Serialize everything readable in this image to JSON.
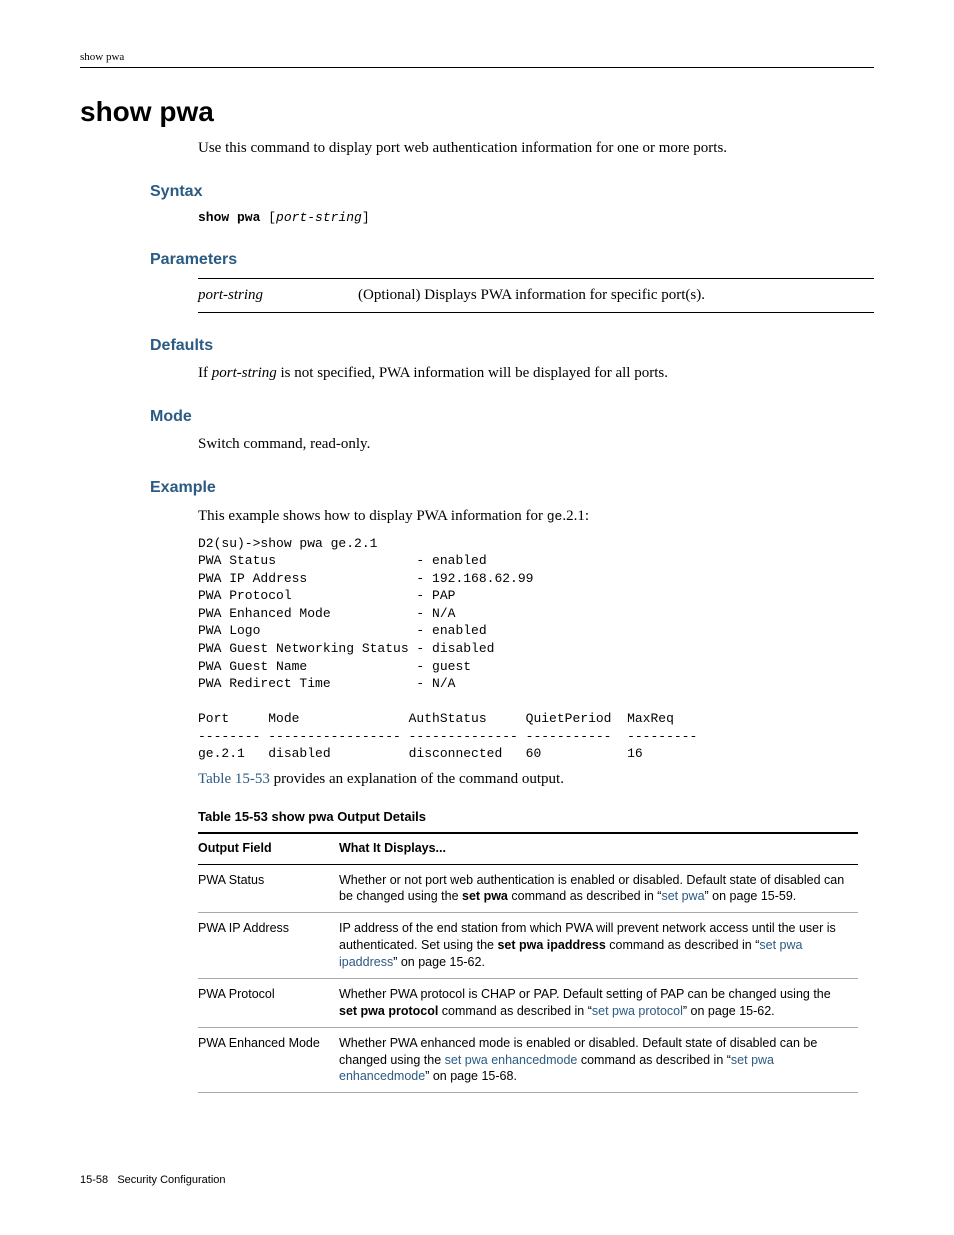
{
  "header": {
    "running": "show pwa"
  },
  "title": "show pwa",
  "intro": "Use this command to display port web authentication information for one or more ports.",
  "syntax": {
    "heading": "Syntax",
    "cmd_bold": "show pwa",
    "cmd_italic": "port-string"
  },
  "parameters": {
    "heading": "Parameters",
    "name": "port-string",
    "desc": "(Optional) Displays PWA information for specific port(s)."
  },
  "defaults": {
    "heading": "Defaults",
    "pre": "If ",
    "italic": "port-string",
    "post": " is not specified, PWA information will be displayed for all ports."
  },
  "mode": {
    "heading": "Mode",
    "text": "Switch command, read-only."
  },
  "example": {
    "heading": "Example",
    "lead_pre": "This example shows how to display PWA information for ",
    "lead_code": "ge",
    "lead_post": ".2.1:",
    "code": "D2(su)->show pwa ge.2.1\nPWA Status                  - enabled\nPWA IP Address              - 192.168.62.99\nPWA Protocol                - PAP\nPWA Enhanced Mode           - N/A\nPWA Logo                    - enabled\nPWA Guest Networking Status - disabled\nPWA Guest Name              - guest\nPWA Redirect Time           - N/A\n\nPort     Mode              AuthStatus     QuietPeriod  MaxReq\n-------- ----------------- -------------- -----------  ---------\nge.2.1   disabled          disconnected   60           16",
    "after_link": "Table 15-53",
    "after_text": " provides an explanation of the command output."
  },
  "table": {
    "caption": "Table 15-53    show pwa Output Details",
    "col1": "Output Field",
    "col2": "What It Displays...",
    "rows": [
      {
        "field": "PWA Status",
        "pre": "Whether or not port web authentication is enabled or disabled. Default state of disabled can be changed using the ",
        "bold": "set pwa",
        "mid": " command as described in “",
        "link": "set pwa",
        "post": "” on page 15-59."
      },
      {
        "field": "PWA IP Address",
        "pre": "IP address of the end station from which PWA will prevent network access until the user is authenticated. Set using the ",
        "bold": "set pwa ipaddress",
        "mid": " command as described in “",
        "link": "set pwa ipaddress",
        "post": "” on page 15-62."
      },
      {
        "field": "PWA Protocol",
        "pre": "Whether PWA protocol is CHAP or PAP. Default setting of PAP can be changed using the ",
        "bold": "set pwa protocol",
        "mid": " command as described in “",
        "link": "set pwa protocol",
        "post": "” on page 15-62."
      },
      {
        "field": "PWA Enhanced Mode",
        "pre": "Whether PWA enhanced mode is enabled or disabled. Default state of disabled can be changed using the ",
        "link1": "set pwa enhancedmode",
        "mid": " command as described in “",
        "link2": "set pwa enhancedmode",
        "post": "” on page 15-68."
      }
    ]
  },
  "footer": {
    "page": "15-58",
    "section": "Security Configuration"
  }
}
